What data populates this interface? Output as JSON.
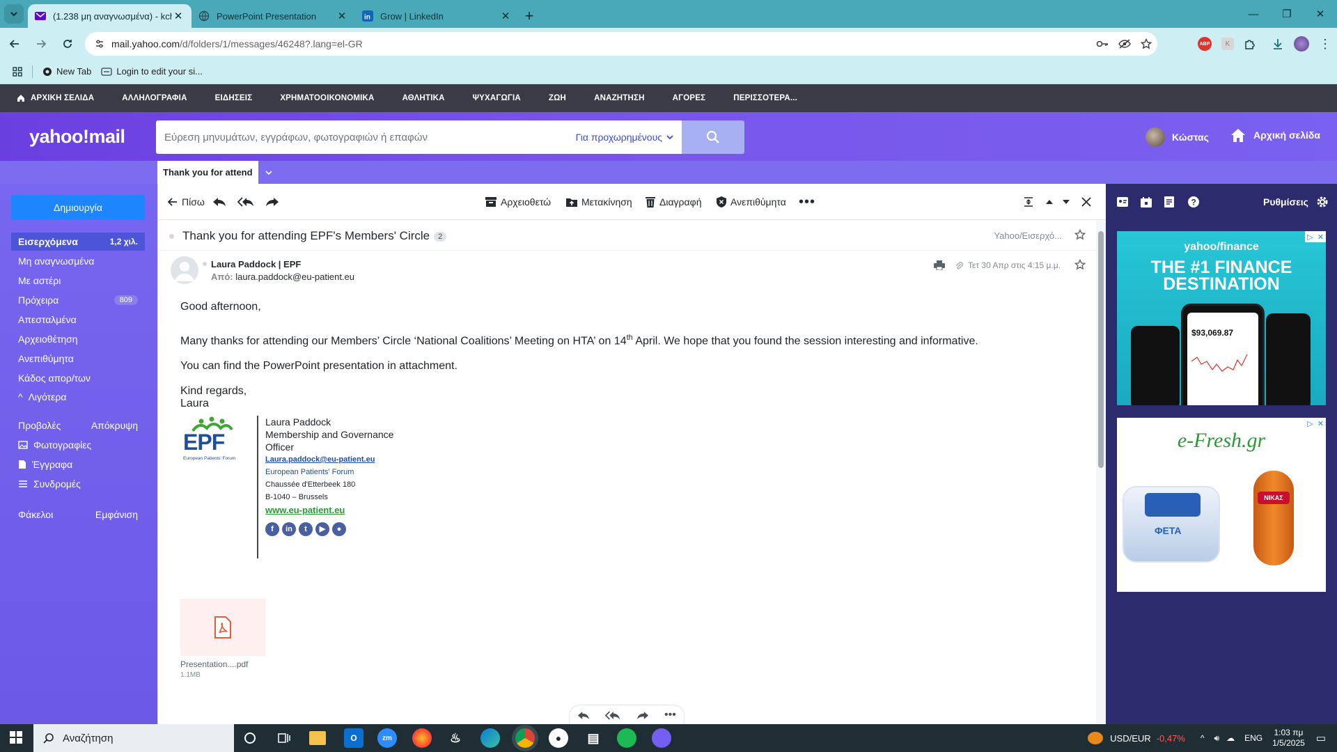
{
  "browser": {
    "tabs": [
      {
        "title": "(1.238 μη αναγνωσμένα) - kcho",
        "active": true,
        "icon": "yahoo-mail-icon"
      },
      {
        "title": "PowerPoint Presentation",
        "active": false,
        "icon": "globe-icon"
      },
      {
        "title": "Grow | LinkedIn",
        "active": false,
        "icon": "linkedin-icon"
      }
    ],
    "url_domain": "mail.yahoo.com",
    "url_path": "/d/folders/1/messages/46248?.lang=el-GR",
    "bookmarks": [
      "New Tab",
      "Login to edit your si..."
    ]
  },
  "ynav": [
    "ΑΡΧΙΚΗ ΣΕΛΙΔΑ",
    "ΑΛΛΗΛΟΓΡΑΦΙΑ",
    "ΕΙΔΗΣΕΙΣ",
    "ΧΡΗΜΑΤΟΟΙΚΟΝΟΜΙΚΑ",
    "ΑΘΛΗΤΙΚΑ",
    "ΨΥΧΑΓΩΓΙΑ",
    "ΖΩΗ",
    "ΑΝΑΖΗΤΗΣΗ",
    "ΑΓΟΡΕΣ",
    "ΠΕΡΙΣΣΟΤΕΡΑ..."
  ],
  "header": {
    "logo": "yahoo!mail",
    "search_placeholder": "Εύρεση μηνυμάτων, εγγράφων, φωτογραφιών ή επαφών",
    "advanced": "Για προχωρημένους",
    "user": "Κώστας",
    "home": "Αρχική σελίδα"
  },
  "msgtab": "Thank you for attend",
  "sidebar": {
    "compose": "Δημιουργία",
    "folders": [
      {
        "label": "Εισερχόμενα",
        "count": "1,2 χιλ.",
        "selected": true
      },
      {
        "label": "Μη αναγνωσμένα",
        "count": ""
      },
      {
        "label": "Με αστέρι",
        "count": ""
      },
      {
        "label": "Πρόχειρα",
        "count": "809"
      },
      {
        "label": "Απεσταλμένα",
        "count": ""
      },
      {
        "label": "Αρχειοθέτηση",
        "count": ""
      },
      {
        "label": "Ανεπιθύμητα",
        "count": ""
      },
      {
        "label": "Κάδος απορ/των",
        "count": ""
      }
    ],
    "less": "Λιγότερα",
    "views": "Προβολές",
    "hide": "Απόκρυψη",
    "photos": "Φωτογραφίες",
    "documents": "Έγγραφα",
    "subscriptions": "Συνδρομές",
    "folders_label": "Φάκελοι",
    "show": "Εμφάνιση"
  },
  "actions": {
    "back": "Πίσω",
    "archive": "Αρχειοθετώ",
    "move": "Μετακίνηση",
    "delete": "Διαγραφή",
    "spam": "Ανεπιθύμητα"
  },
  "message": {
    "subject": "Thank you for attending EPF's Members' Circle",
    "thread_count": "2",
    "folder": "Yahoo/Εισερχό...",
    "sender_name": "Laura Paddock | EPF",
    "from_label": "Από:",
    "from_email": "laura.paddock@eu-patient.eu",
    "date": "Τετ 30 Απρ στις 4:15 μ.μ.",
    "greeting": "Good afternoon,",
    "para1_a": "Many thanks for attending our Members’ Circle ‘National Coalitions’ Meeting on HTA’ on 14",
    "para1_sup": "th",
    "para1_b": " April. We hope that you found the session interesting and informative.",
    "para2": "You can find the PowerPoint presentation in attachment.",
    "closing": "Kind regards,",
    "signoff": "Laura"
  },
  "signature": {
    "logo_text": "EPF",
    "logo_sub": "European Patients' Forum",
    "name": "Laura Paddock",
    "title1": "Membership and Governance",
    "title2": "Officer",
    "email": "Laura.paddock@eu-patient.eu",
    "org": "European Patients' Forum",
    "street": "Chaussée d'Etterbeek 180",
    "city": "B-1040 – Brussels",
    "web": "www.eu-patient.eu"
  },
  "attachment": {
    "name": "Presentation....pdf",
    "size": "1.1MB"
  },
  "rail": {
    "settings": "Ρυθμίσεις"
  },
  "ads": {
    "ad1_brand": "yahoo/finance",
    "ad1_headline1": "THE #1 FINANCE",
    "ad1_headline2": "DESTINATION",
    "ad1_value": "$93,069.87",
    "ad2_brand": "e-Fresh.gr",
    "ad2_product": "ΦΕΤΑ",
    "ad2_brand2": "ΝΙΚΑΣ"
  },
  "taskbar": {
    "search": "Αναζήτηση",
    "currency": "USD/EUR",
    "change": "-0,47%",
    "lang": "ENG",
    "time": "1:03 πμ",
    "date": "1/5/2025"
  },
  "colors": {
    "yahoo_purple": "#6a3fe0",
    "compose_blue": "#1d86ff",
    "tab_teal": "#4aa9b8",
    "change_red": "#ff5a5a"
  }
}
